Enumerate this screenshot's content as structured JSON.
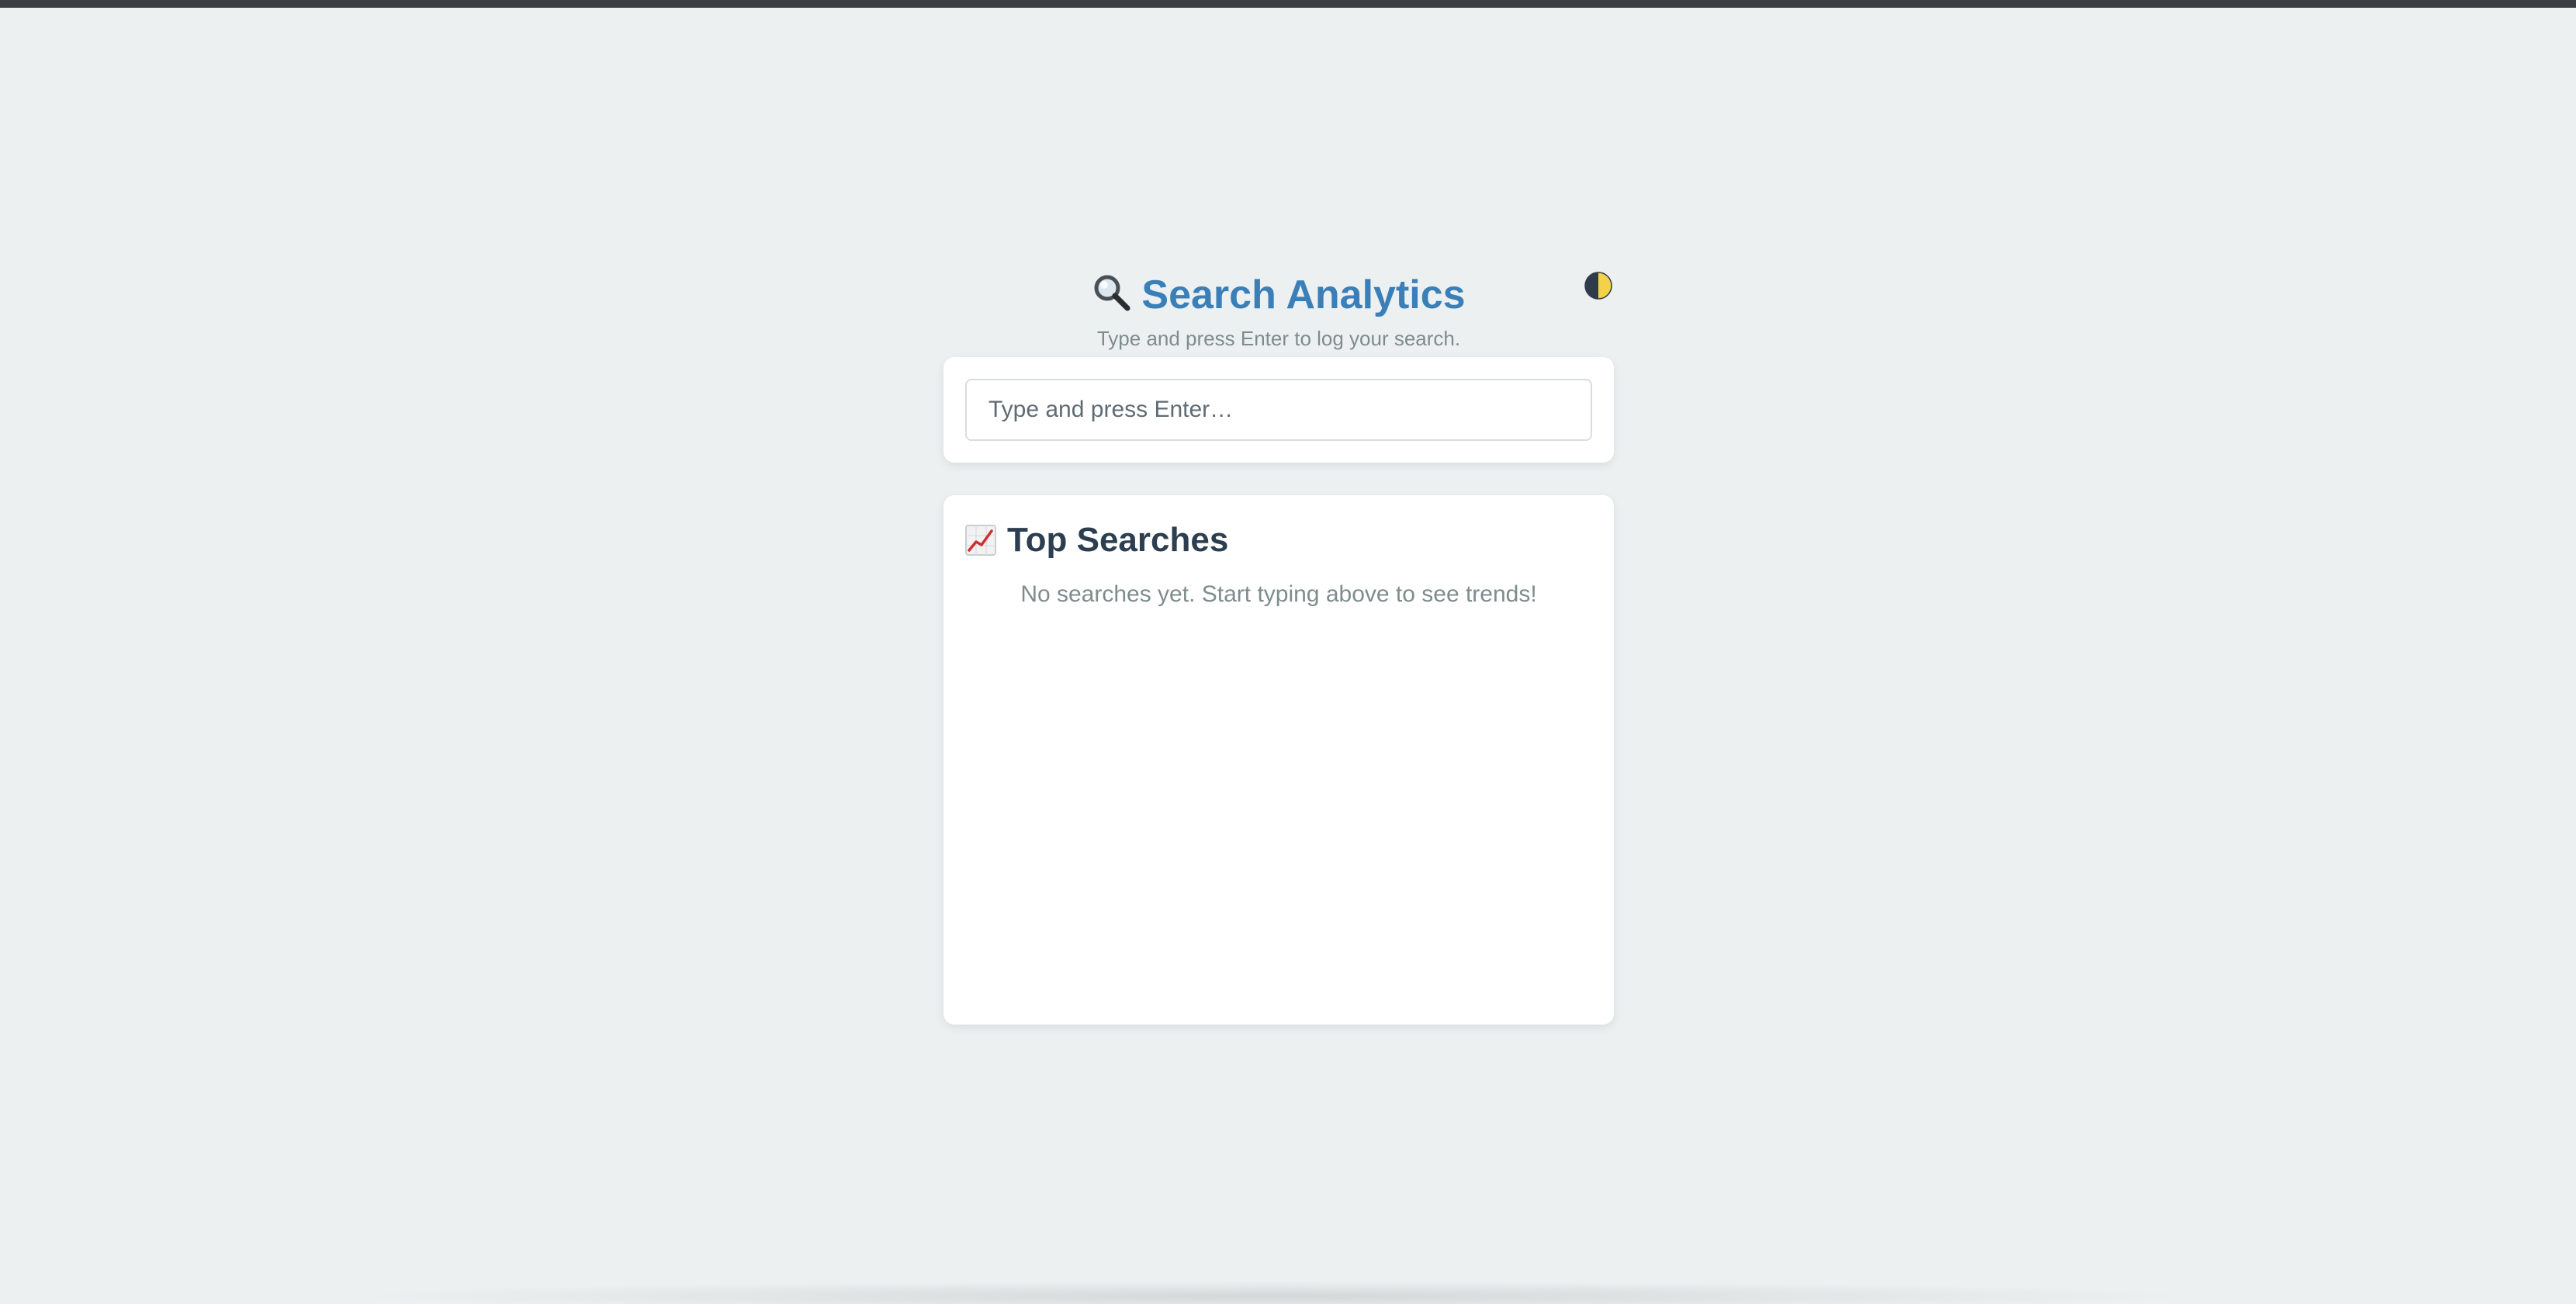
{
  "header": {
    "title": "Search Analytics",
    "title_icon": "magnifier-icon",
    "subtitle": "Type and press Enter to log your search.",
    "theme_toggle_icon": "half-moon-icon"
  },
  "search": {
    "placeholder": "Type and press Enter…",
    "value": ""
  },
  "top_searches": {
    "heading": "Top Searches",
    "heading_icon": "chart-increasing-icon",
    "empty_message": "No searches yet. Start typing above to see trends!"
  },
  "colors": {
    "background": "#ecf0f1",
    "accent": "#3a7fb8",
    "heading": "#2c3e50",
    "muted": "#7f8c8d"
  }
}
